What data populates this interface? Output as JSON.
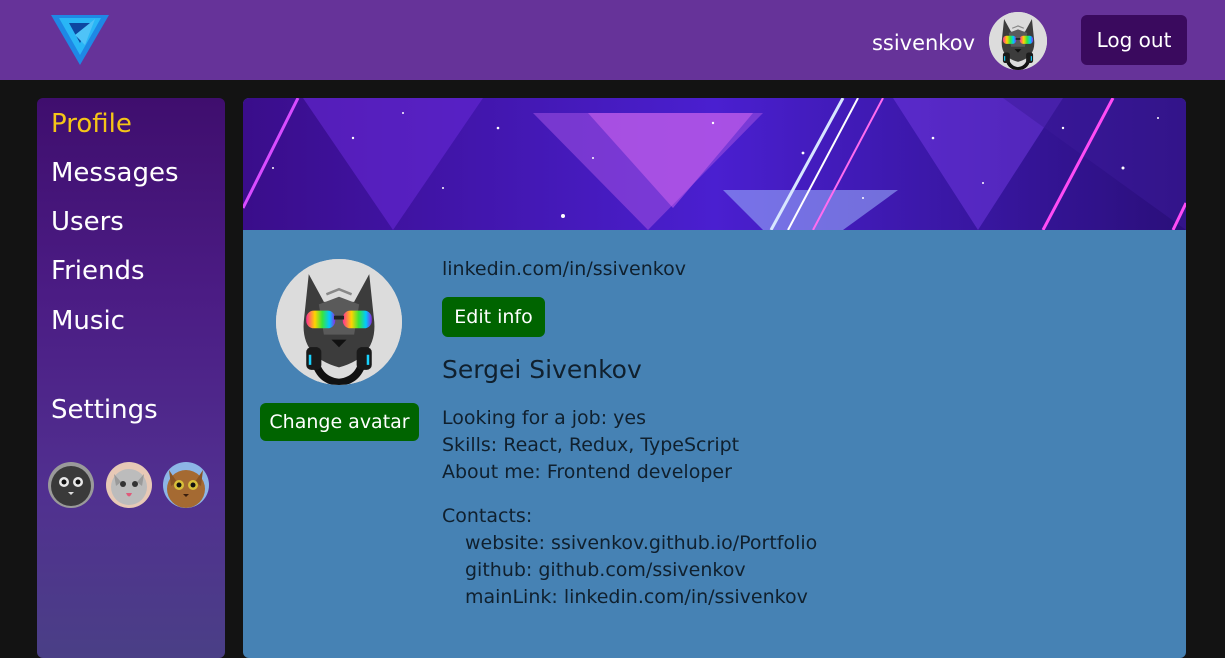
{
  "header": {
    "logo_icon": "triangle-logo-icon",
    "username": "ssivenkov",
    "logout_label": "Log out"
  },
  "sidebar": {
    "items": [
      {
        "label": "Profile",
        "active": true
      },
      {
        "label": "Messages",
        "active": false
      },
      {
        "label": "Users",
        "active": false
      },
      {
        "label": "Friends",
        "active": false
      },
      {
        "label": "Music",
        "active": false
      }
    ],
    "settings_label": "Settings",
    "active_color": "#f5c518"
  },
  "profile": {
    "link": "linkedin.com/in/ssivenkov",
    "edit_label": "Edit info",
    "change_avatar_label": "Change avatar",
    "name": "Sergei Sivenkov",
    "job": "Looking for a job: yes",
    "skills": "Skills: React, Redux, TypeScript",
    "about": "About me: Frontend developer",
    "contacts_label": "Contacts:",
    "contacts": [
      "website: ssivenkov.github.io/Portfolio",
      "github: github.com/ssivenkov",
      "mainLink: linkedin.com/in/ssivenkov"
    ]
  },
  "colors": {
    "header_bg": "#663399",
    "content_bg": "#4682b4",
    "button_green": "#006400",
    "logout_bg": "#3a0a5e"
  }
}
